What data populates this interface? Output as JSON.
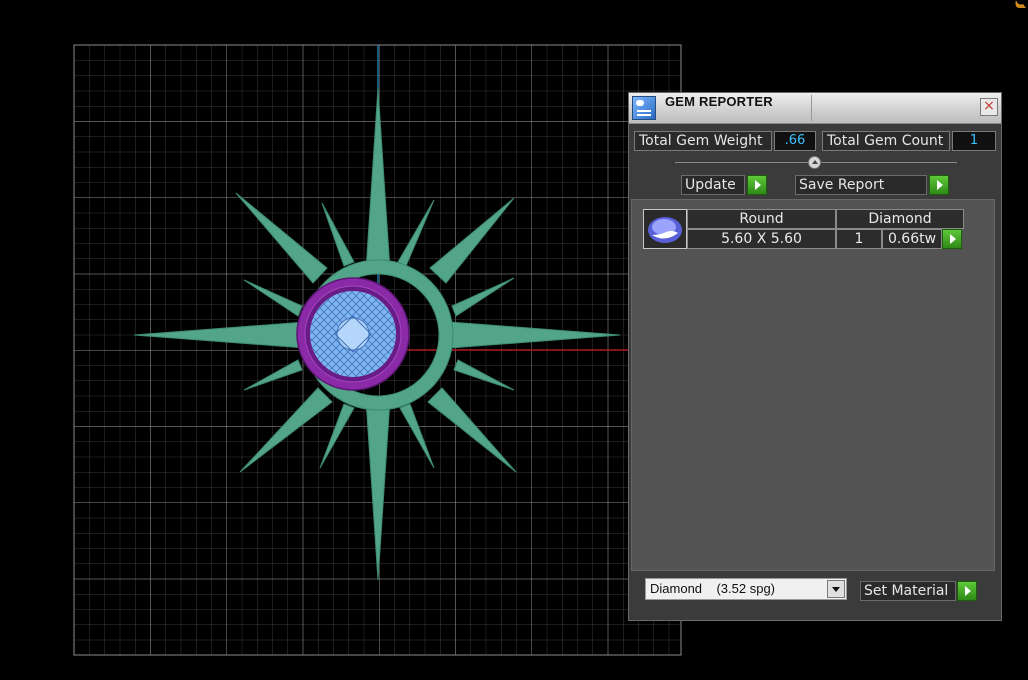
{
  "panel": {
    "title": "GEM REPORTER",
    "close_label": "×",
    "total_weight_label": "Total Gem Weight",
    "total_weight_value": ".66",
    "total_count_label": "Total Gem Count",
    "total_count_value": "1",
    "update_label": "Update",
    "save_report_label": "Save Report",
    "gems": [
      {
        "shape": "Round",
        "material": "Diamond",
        "size": "5.60 X 5.60",
        "count": "1",
        "weight": "0.66tw"
      }
    ],
    "material_select": {
      "value": "Diamond    (3.52 spg)"
    },
    "set_material_label": "Set Material"
  },
  "icons": {
    "title": "gem-reporter-icon",
    "gem_thumbnail": "round-gem-icon",
    "action_buttons": "green-arrow-icon",
    "dropdown": "chevron-down-icon"
  },
  "colors": {
    "ring": "#52a588",
    "gem_setting": "#8a2aa6",
    "gem": "#7fb6f2",
    "axis_x": "#b11a1a",
    "axis_y": "#1a74a8",
    "value_text": "#3ac3ff",
    "accent_button": "#3ea520"
  }
}
